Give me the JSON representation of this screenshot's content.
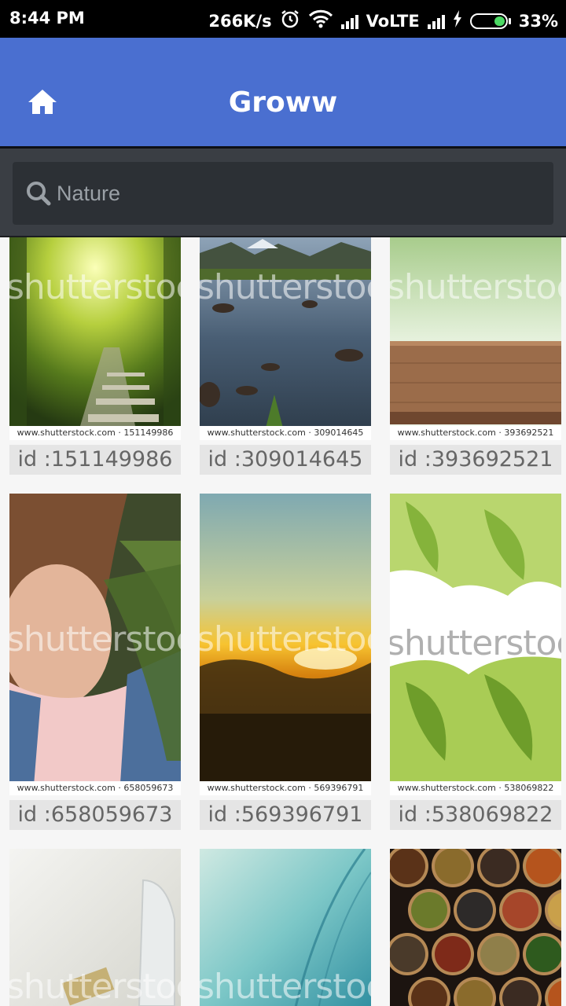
{
  "status_bar": {
    "time": "8:44 PM",
    "speed": "266K/s",
    "network": "VoLTE",
    "battery": "33%",
    "battery_level": 0.33,
    "alarm_icon": "alarm-icon",
    "wifi_icon": "wifi-icon",
    "charging_icon": "bolt-icon"
  },
  "app_bar": {
    "title": "Groww",
    "home_icon": "home-icon",
    "color": "#4a6fd0"
  },
  "search": {
    "value": "",
    "placeholder": "Nature",
    "icon": "search-icon"
  },
  "grid": {
    "items": [
      {
        "id_label": "id :151149986",
        "credit": "www.shutterstock.com · 151149986",
        "watermark": "shutterstock"
      },
      {
        "id_label": "id :309014645",
        "credit": "www.shutterstock.com · 309014645",
        "watermark": "shutterstock"
      },
      {
        "id_label": "id :393692521",
        "credit": "www.shutterstock.com · 393692521",
        "watermark": "shutterstock"
      },
      {
        "id_label": "id :658059673",
        "credit": "www.shutterstock.com · 658059673",
        "watermark": "shutterstock"
      },
      {
        "id_label": "id :569396791",
        "credit": "www.shutterstock.com · 569396791",
        "watermark": "shutterstock"
      },
      {
        "id_label": "id :538069822",
        "credit": "www.shutterstock.com · 538069822",
        "watermark": "shutterstock"
      },
      {
        "id_label": "",
        "credit": "",
        "watermark": "shutterstock"
      },
      {
        "id_label": "",
        "credit": "",
        "watermark": "shutterstock"
      },
      {
        "id_label": "",
        "credit": "",
        "watermark": ""
      }
    ]
  }
}
